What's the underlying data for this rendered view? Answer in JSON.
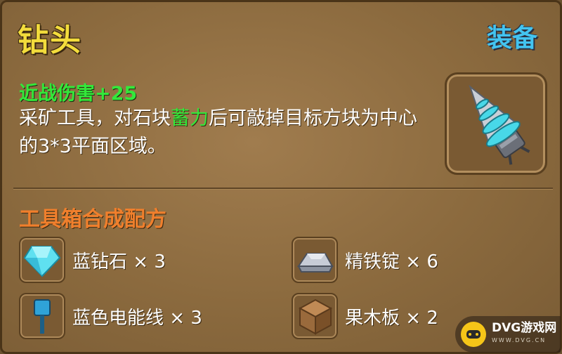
{
  "item": {
    "name": "钻头",
    "tag": "装备",
    "stat": "近战伤害+25",
    "desc_part1": "采矿工具，对石块",
    "desc_highlight": "蓄力",
    "desc_part2": "后可敲掉目标方块为中心的3*3平面区域。"
  },
  "recipe": {
    "title": "工具箱合成配方",
    "ingredients": [
      {
        "label": "蓝钻石 × 3",
        "icon": "blue-diamond-icon"
      },
      {
        "label": "精铁锭 × 6",
        "icon": "iron-ingot-icon"
      },
      {
        "label": "蓝色电能线 × 3",
        "icon": "blue-wire-icon"
      },
      {
        "label": "果木板 × 2",
        "icon": "wood-plank-icon"
      }
    ]
  },
  "watermark": {
    "text": "DVG游戏网",
    "sub": "WWW.DVG.CN"
  },
  "colors": {
    "title": "#f3dc3c",
    "tag": "#43c4f0",
    "stat": "#33e83a",
    "section": "#f07f2c"
  }
}
